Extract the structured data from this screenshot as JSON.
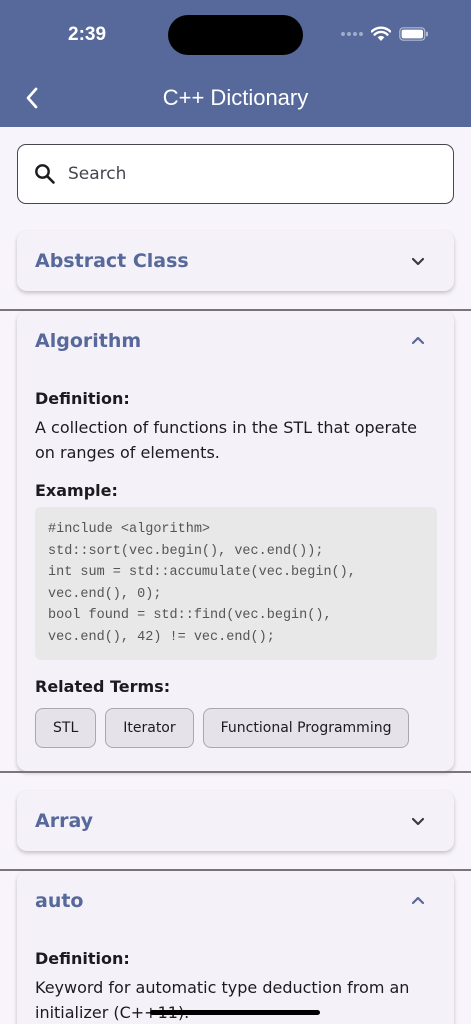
{
  "status": {
    "time": "2:39"
  },
  "header": {
    "title": "C++ Dictionary",
    "back_icon": "chevron-left-icon"
  },
  "search": {
    "placeholder": "Search",
    "value": "",
    "icon": "search-icon"
  },
  "terms": [
    {
      "title": "Abstract Class",
      "expanded": false
    },
    {
      "title": "Algorithm",
      "expanded": true,
      "definition_label": "Definition:",
      "definition_lines": [
        "A collection of functions in the STL that operate",
        "on ranges of elements."
      ],
      "example_label": "Example:",
      "example_lines": [
        "#include <algorithm>",
        "std::sort(vec.begin(), vec.end());",
        "int sum = std::accumulate(vec.begin(),",
        "vec.end(), 0);",
        "bool found = std::find(vec.begin(),",
        "vec.end(), 42) != vec.end();"
      ],
      "related_label": "Related Terms:",
      "related": [
        "STL",
        "Iterator",
        "Functional Programming"
      ]
    },
    {
      "title": "Array",
      "expanded": false
    },
    {
      "title": "auto",
      "expanded": true,
      "definition_label": "Definition:",
      "definition_lines": [
        "Keyword for automatic type deduction from an",
        "initializer (C++11)."
      ]
    }
  ],
  "colors": {
    "appbar": "#56699a",
    "accent": "#56699a",
    "background": "#f8f4fb"
  }
}
